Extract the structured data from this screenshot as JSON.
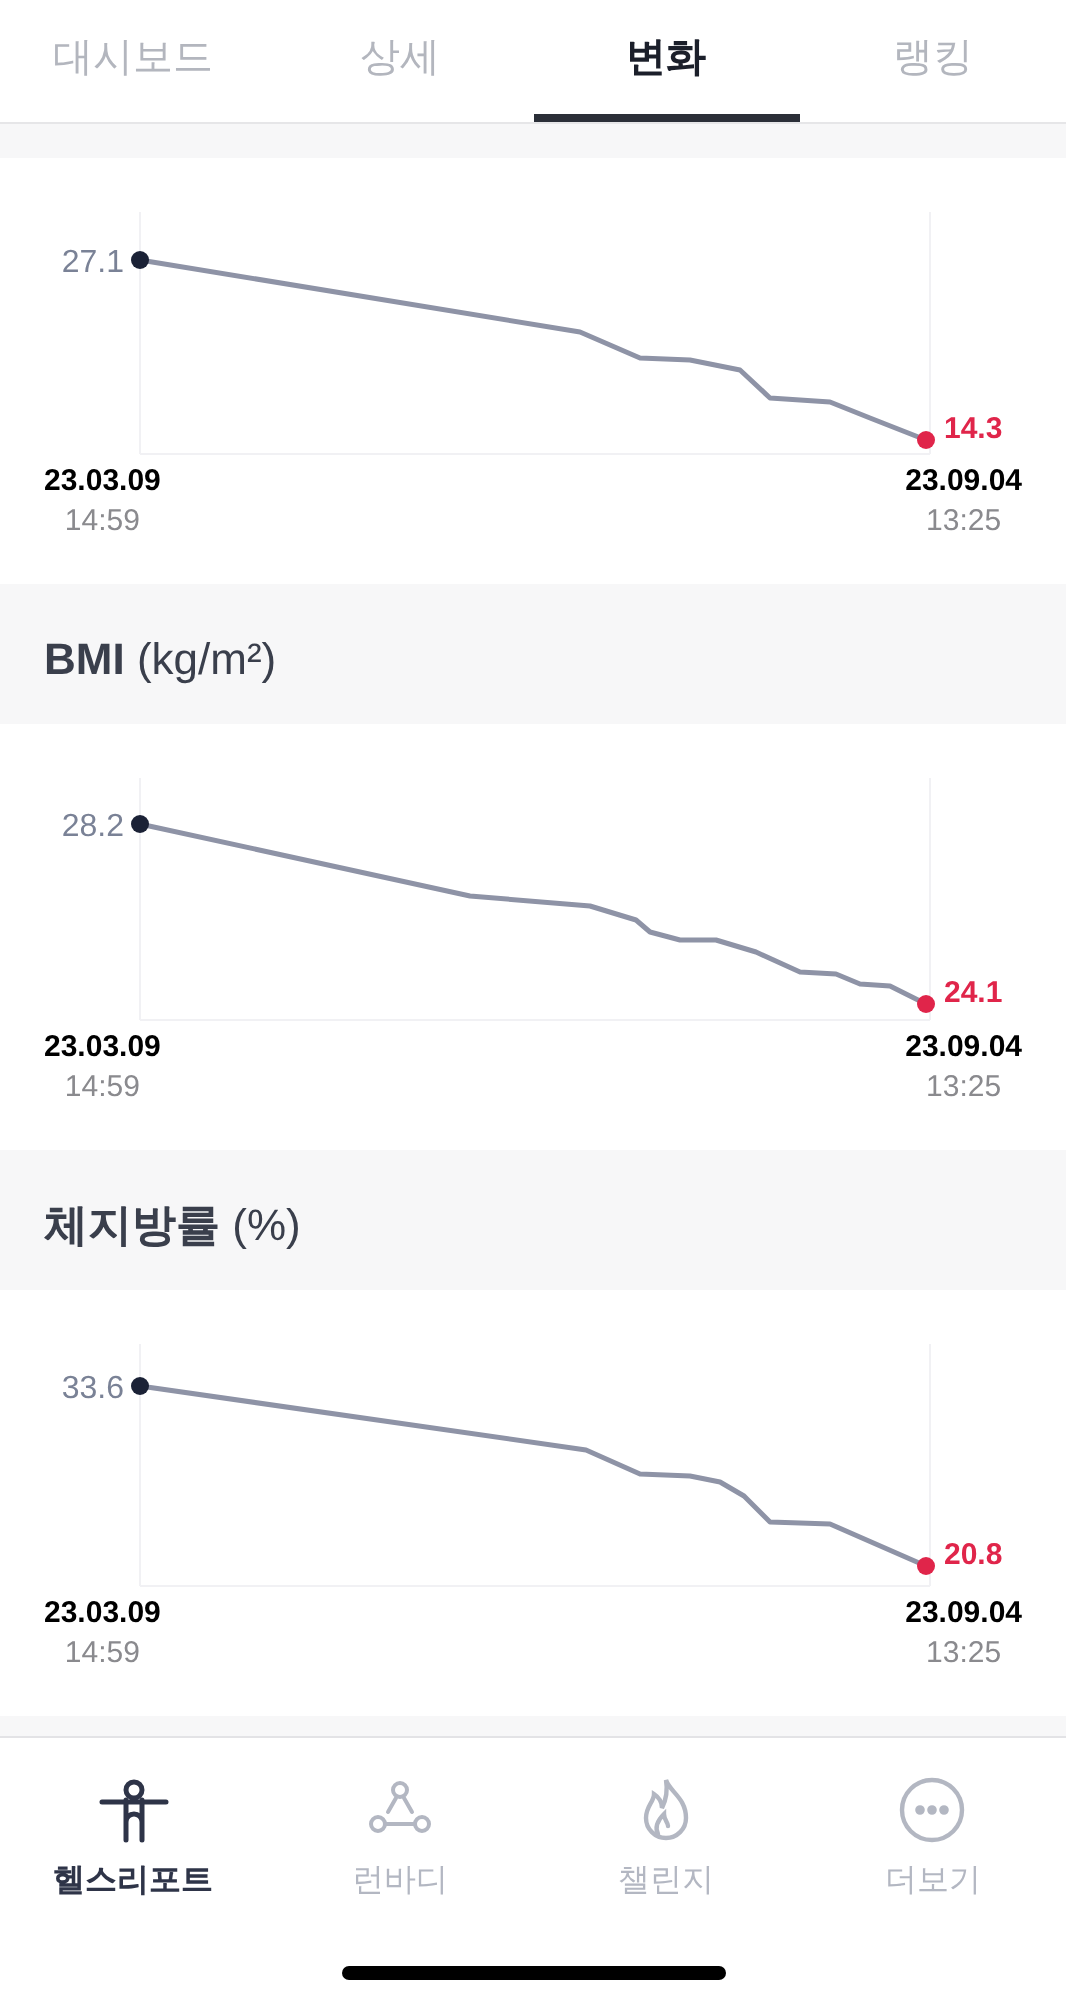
{
  "tabs": [
    {
      "label": "대시보드",
      "selected": false
    },
    {
      "label": "상세",
      "selected": false
    },
    {
      "label": "변화",
      "selected": true
    },
    {
      "label": "랭킹",
      "selected": false
    }
  ],
  "sections": [
    {
      "chart": {
        "start_value": "27.1",
        "end_value": "14.3",
        "start_date": "23.03.09",
        "start_time": "14:59",
        "end_date": "23.09.04",
        "end_time": "13:25"
      }
    },
    {
      "title": "**BMI** (kg/m²)",
      "chart": {
        "start_value": "28.2",
        "end_value": "24.1",
        "start_date": "23.03.09",
        "start_time": "14:59",
        "end_date": "23.09.04",
        "end_time": "13:25"
      }
    },
    {
      "title": "**체지방률** (%)",
      "chart": {
        "start_value": "33.6",
        "end_value": "20.8",
        "start_date": "23.03.09",
        "start_time": "14:59",
        "end_date": "23.09.04",
        "end_time": "13:25"
      }
    }
  ],
  "bottom_nav": [
    {
      "kind": "person",
      "label": "헬스리포트",
      "selected": true
    },
    {
      "kind": "nodes",
      "label": "런바디",
      "selected": false
    },
    {
      "kind": "flame",
      "label": "챌린지",
      "selected": false
    },
    {
      "kind": "more",
      "label": "더보기",
      "selected": false
    }
  ]
}
